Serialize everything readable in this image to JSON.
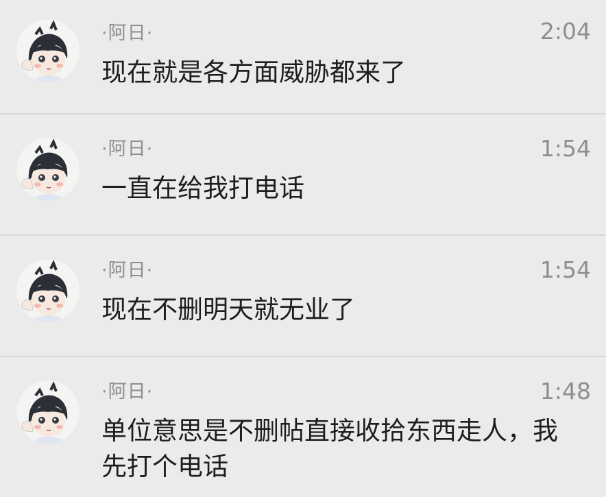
{
  "messages": [
    {
      "sender": "·阿日·",
      "time": "2:04",
      "text": "现在就是各方面威胁都来了"
    },
    {
      "sender": "·阿日·",
      "time": "1:54",
      "text": "一直在给我打电话"
    },
    {
      "sender": "·阿日·",
      "time": "1:54",
      "text": "现在不删明天就无业了"
    },
    {
      "sender": "·阿日·",
      "time": "1:48",
      "text": "单位意思是不删帖直接收拾东西走人，我先打个电话"
    }
  ],
  "colors": {
    "background": "#ebebeb",
    "divider": "#d6d6d6",
    "meta_text": "#8e8e8e",
    "message_text": "#1e1e1e"
  },
  "icons": {
    "avatar": "cartoon-boy-avatar"
  }
}
